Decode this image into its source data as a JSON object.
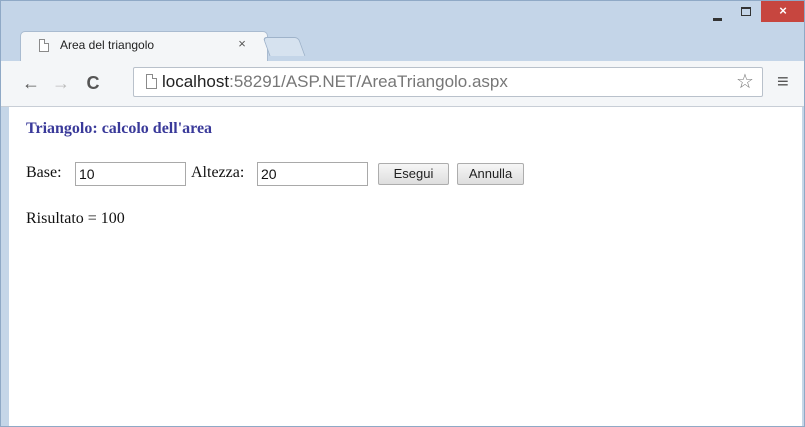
{
  "browser": {
    "tab_title": "Area del triangolo",
    "tab_close": "×",
    "window_controls": {
      "minimize": "",
      "maximize": "",
      "close": "×"
    },
    "url_host": "localhost",
    "url_rest": ":58291/ASP.NET/AreaTriangolo.aspx",
    "star": "☆",
    "menu": "≡",
    "back": "←",
    "forward": "→",
    "reload": "C"
  },
  "page": {
    "title": "Triangolo: calcolo dell'area",
    "base_label": "Base:",
    "base_value": "10",
    "altezza_label": "Altezza:",
    "altezza_value": "20",
    "esegui_label": "Esegui",
    "annulla_label": "Annulla",
    "result_text": "Risultato = 100"
  },
  "colors": {
    "title_color": "#3a3a9a",
    "close_button": "#c7463f",
    "frame": "#c4d5e8"
  }
}
